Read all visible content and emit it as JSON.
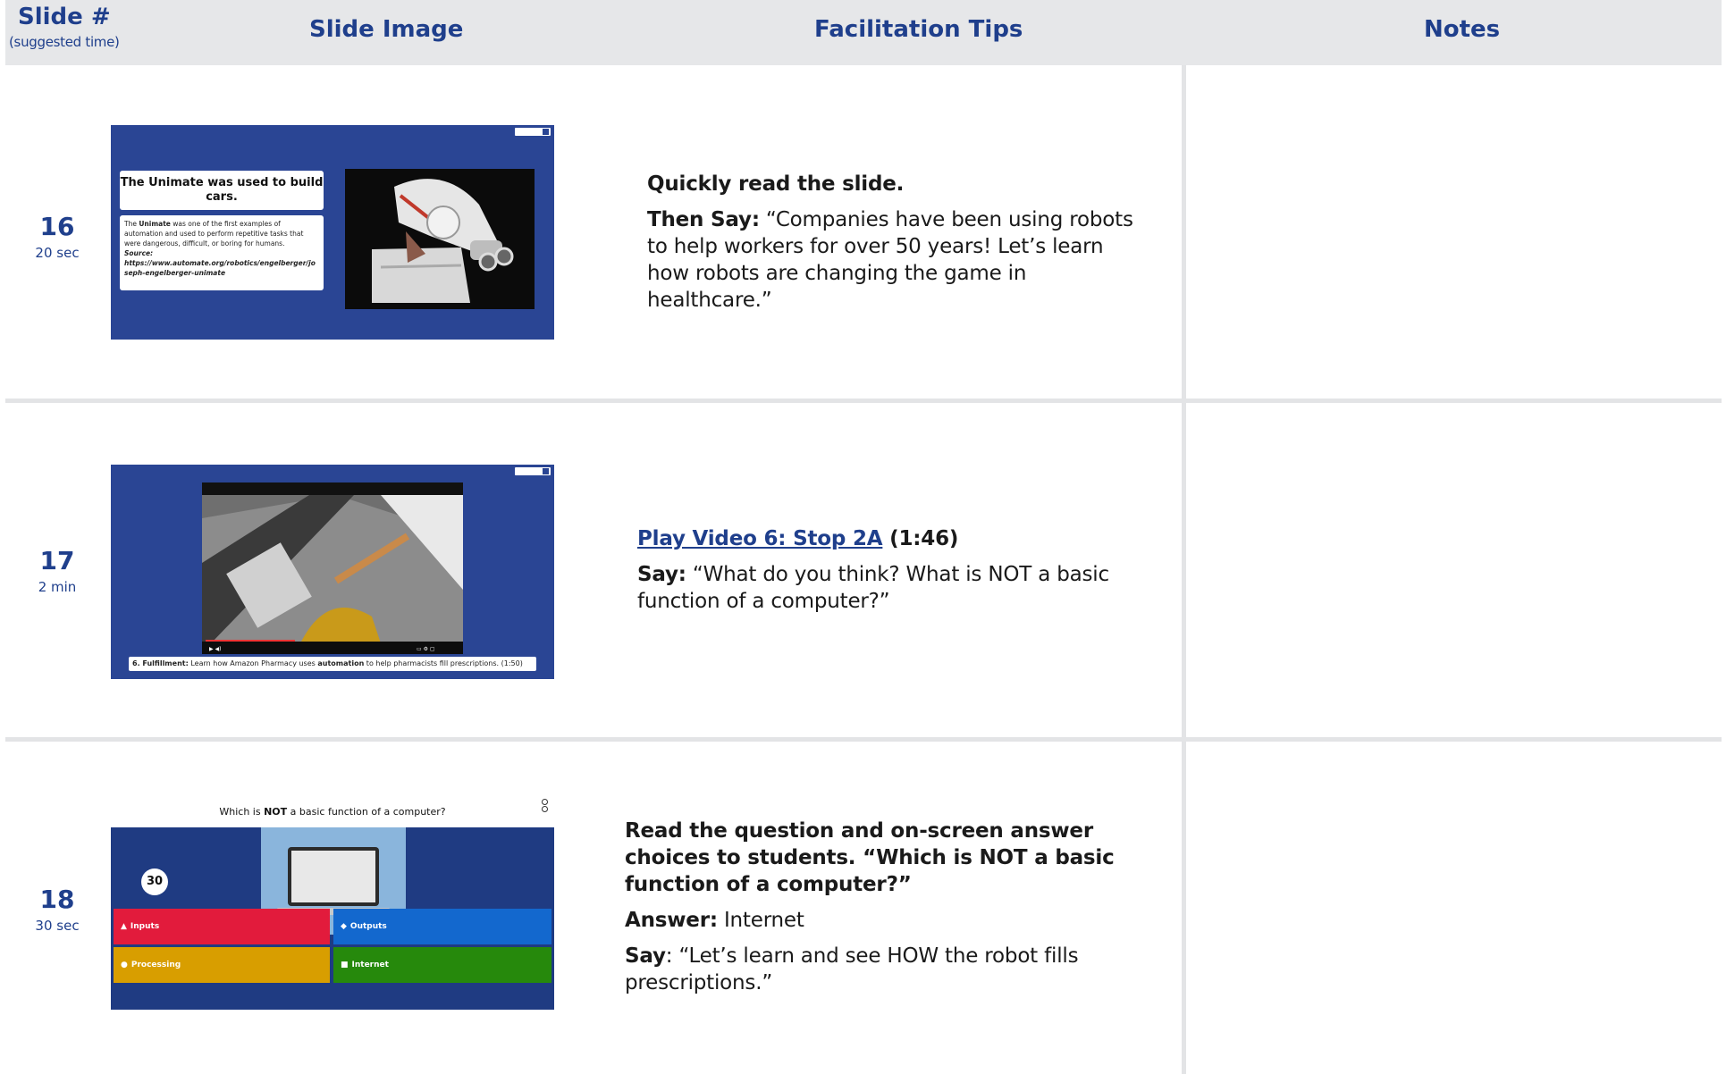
{
  "header": {
    "slide_col_label": "Slide #",
    "slide_col_sub": "(suggested time)",
    "image_col_label": "Slide Image",
    "tips_col_label": "Facilitation Tips",
    "notes_col_label": "Notes"
  },
  "rows": [
    {
      "slide_number": "16",
      "time": "20 sec",
      "thumbnail": {
        "title": "The Unimate was used to build cars.",
        "body_prefix": "The ",
        "body_bold": "Unimate",
        "body_rest": " was one of the first examples of automation and used to perform repetitive tasks that were dangerous, difficult, or boring for humans.",
        "source_label": "Source:",
        "source_url": "https://www.automate.org/robotics/engelberger/joseph-engelberger-unimate",
        "photo_icon": "robot-arm-photo"
      },
      "tips": {
        "line1": "Quickly read the slide.",
        "line2_label": "Then Say:",
        "line2_text": " “Companies have been using robots to help workers for over 50 years! Let’s learn how robots are changing the game in healthcare.”"
      }
    },
    {
      "slide_number": "17",
      "time": "2 min",
      "thumbnail": {
        "caption_bold": "6. Fulfillment:",
        "caption_text": " Learn how Amazon Pharmacy uses ",
        "caption_bold2": "automation",
        "caption_text2": " to help pharmacists fill prescriptions. (1:50)",
        "video_icon": "warehouse-video-frame"
      },
      "tips": {
        "link_text": "Play Video 6: Stop 2A",
        "duration": " (1:46)",
        "say_label": "Say:",
        "say_text": " “What do you think? What is NOT a basic function of a computer?”"
      }
    },
    {
      "slide_number": "18",
      "time": "30 sec",
      "thumbnail": {
        "question_pre": "Which is ",
        "question_bold": "NOT",
        "question_post": " a basic function of a computer?",
        "timer": "30",
        "answers": [
          "Inputs",
          "Outputs",
          "Processing",
          "Internet"
        ],
        "answer_symbols": [
          "▲",
          "◆",
          "●",
          "■"
        ],
        "answer_colors": [
          "#e21b3c",
          "#1368ce",
          "#d89e00",
          "#26890c"
        ],
        "image_icon": "laptop-icon"
      },
      "tips": {
        "line1": "Read the question and on-screen answer choices to students. “Which is NOT a basic function of a computer?”",
        "answer_label": "Answer:",
        "answer_text": " Internet",
        "say_label": "Say",
        "say_text": ": “Let’s learn and see HOW the robot fills prescriptions.”"
      }
    }
  ],
  "colors": {
    "header_bg": "#e6e7e9",
    "accent_blue": "#1f3f8c",
    "slide_bg": "#2a4594",
    "divider": "#e3e4e6"
  }
}
